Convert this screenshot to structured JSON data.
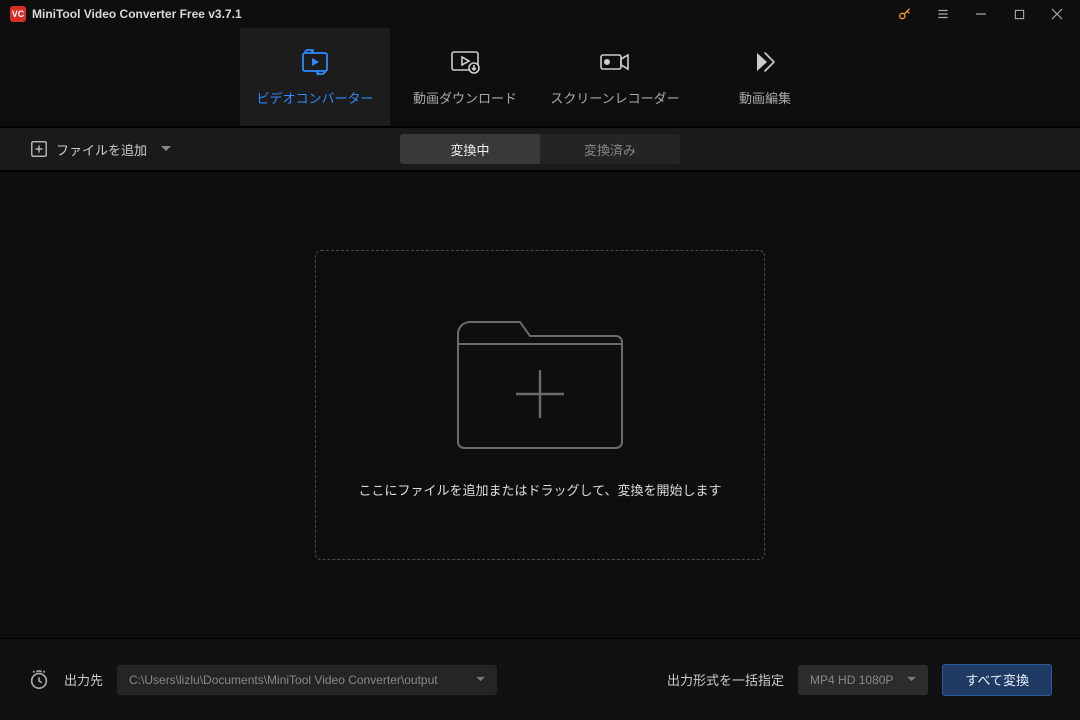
{
  "titlebar": {
    "app_name": "MiniTool Video Converter Free v3.7.1"
  },
  "top_tabs": {
    "converter": "ビデオコンバーター",
    "download": "動画ダウンロード",
    "recorder": "スクリーンレコーダー",
    "editor": "動画編集"
  },
  "sub_bar": {
    "add_file": "ファイルを追加",
    "status_active": "変換中",
    "status_done": "変換済み"
  },
  "drop_zone": {
    "text": "ここにファイルを追加またはドラッグして、変換を開始します"
  },
  "bottom": {
    "output_label": "出力先",
    "output_path": "C:\\Users\\lizlu\\Documents\\MiniTool Video Converter\\output",
    "format_label": "出力形式を一括指定",
    "format_value": "MP4 HD 1080P",
    "convert_all": "すべて変換"
  }
}
